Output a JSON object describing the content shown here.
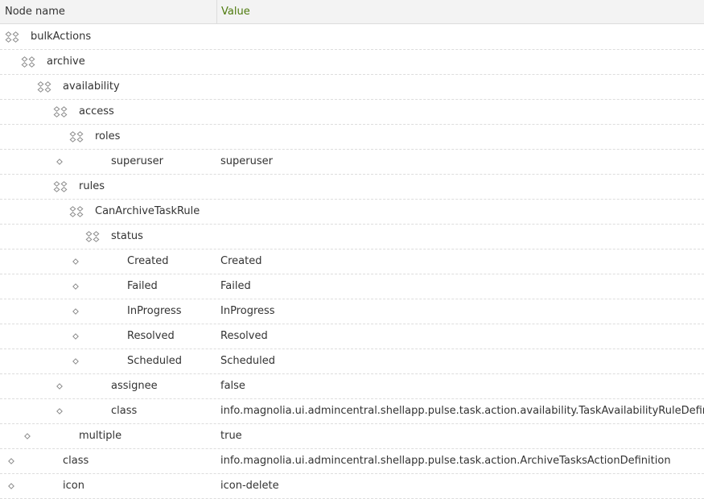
{
  "header": {
    "name_label": "Node name",
    "value_label": "Value"
  },
  "rows": [
    {
      "name": "bulkActions",
      "value": "",
      "type": "folder",
      "depth": 0
    },
    {
      "name": "archive",
      "value": "",
      "type": "folder",
      "depth": 1
    },
    {
      "name": "availability",
      "value": "",
      "type": "folder",
      "depth": 2
    },
    {
      "name": "access",
      "value": "",
      "type": "folder",
      "depth": 3
    },
    {
      "name": "roles",
      "value": "",
      "type": "folder",
      "depth": 4
    },
    {
      "name": "superuser",
      "value": "superuser",
      "type": "property",
      "depth": 5
    },
    {
      "name": "rules",
      "value": "",
      "type": "folder",
      "depth": 3
    },
    {
      "name": "CanArchiveTaskRule",
      "value": "",
      "type": "folder",
      "depth": 4
    },
    {
      "name": "status",
      "value": "",
      "type": "folder",
      "depth": 5
    },
    {
      "name": "Created",
      "value": "Created",
      "type": "property",
      "depth": 6
    },
    {
      "name": "Failed",
      "value": "Failed",
      "type": "property",
      "depth": 6
    },
    {
      "name": "InProgress",
      "value": "InProgress",
      "type": "property",
      "depth": 6
    },
    {
      "name": "Resolved",
      "value": "Resolved",
      "type": "property",
      "depth": 6
    },
    {
      "name": "Scheduled",
      "value": "Scheduled",
      "type": "property",
      "depth": 6
    },
    {
      "name": "assignee",
      "value": "false",
      "type": "property",
      "depth": 5
    },
    {
      "name": "class",
      "value": "info.magnolia.ui.admincentral.shellapp.pulse.task.action.availability.TaskAvailabilityRuleDefinition",
      "type": "property",
      "depth": 5
    },
    {
      "name": "multiple",
      "value": "true",
      "type": "property",
      "depth": 3
    },
    {
      "name": "class",
      "value": "info.magnolia.ui.admincentral.shellapp.pulse.task.action.ArchiveTasksActionDefinition",
      "type": "property",
      "depth": 2
    },
    {
      "name": "icon",
      "value": "icon-delete",
      "type": "property",
      "depth": 2
    }
  ]
}
